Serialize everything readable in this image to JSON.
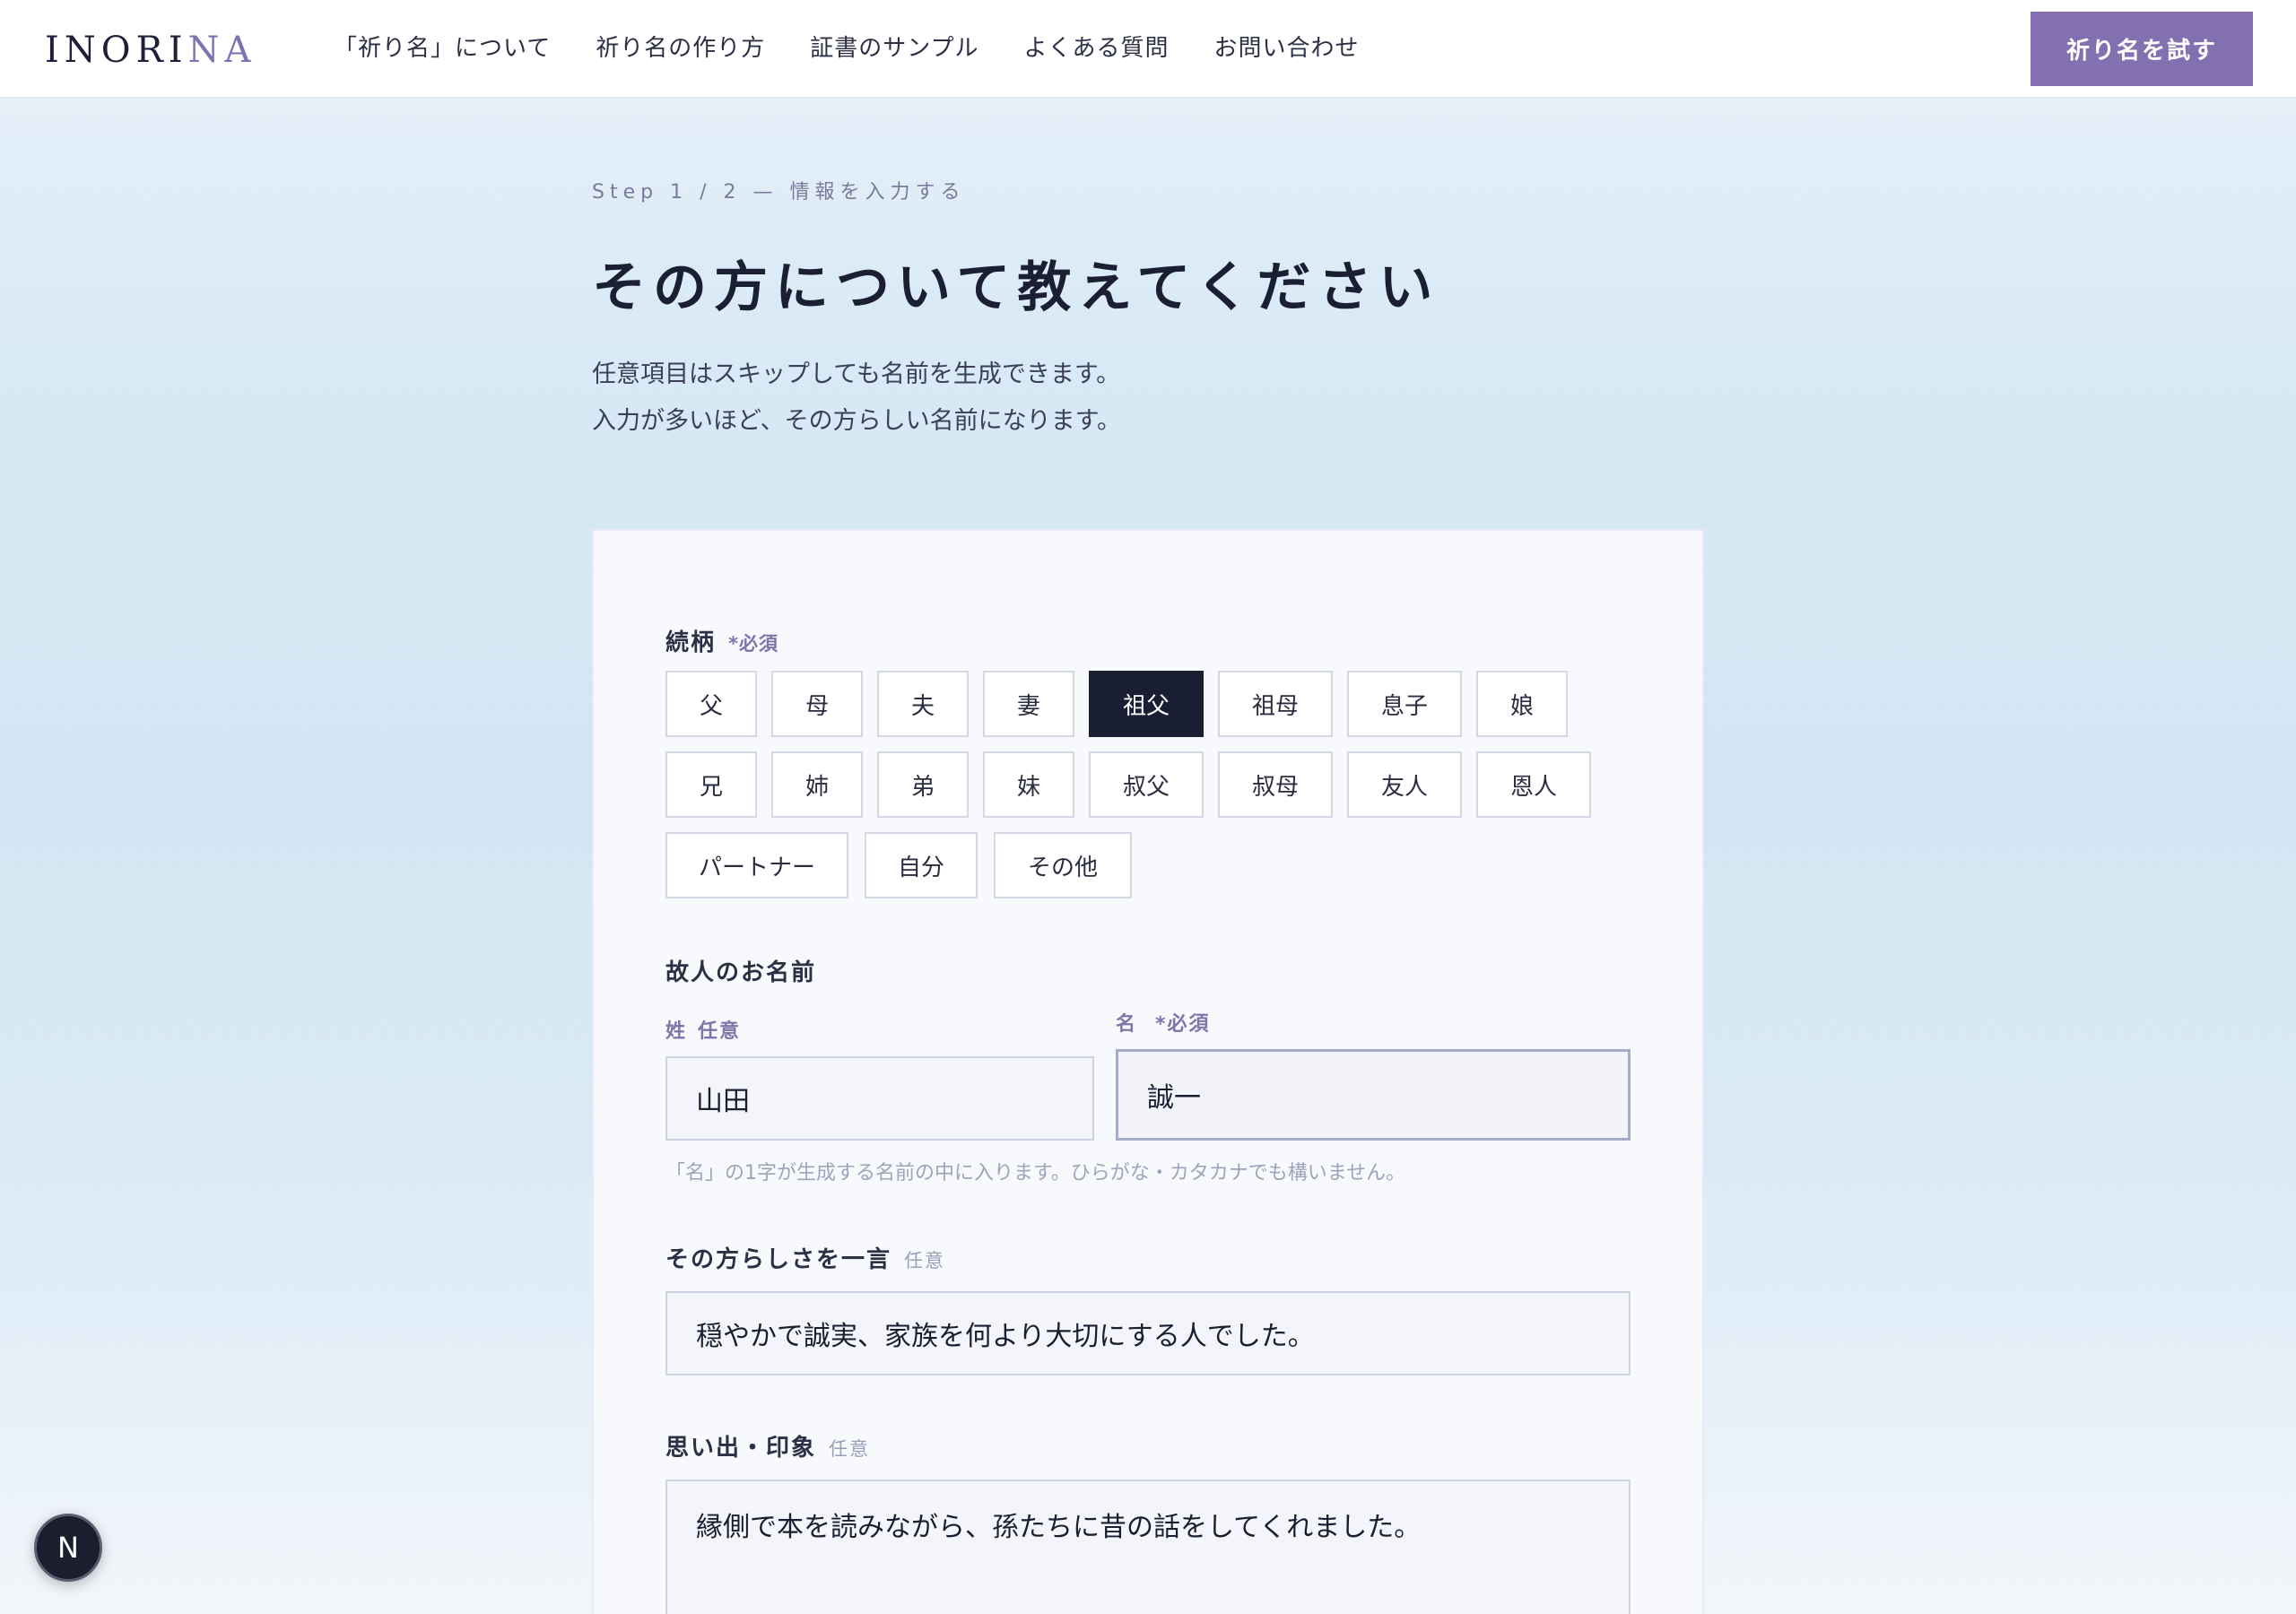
{
  "header": {
    "logo_main": "INORI",
    "logo_accent": "NA",
    "nav": [
      {
        "label": "「祈り名」について"
      },
      {
        "label": "祈り名の作り方"
      },
      {
        "label": "証書のサンプル"
      },
      {
        "label": "よくある質問"
      },
      {
        "label": "お問い合わせ"
      }
    ],
    "cta": "祈り名を試す"
  },
  "intro": {
    "step": "Step 1 / 2 — 情報を入力する",
    "title": "その方について教えてください",
    "desc_line1": "任意項目はスキップしても名前を生成できます。",
    "desc_line2": "入力が多いほど、その方らしい名前になります。"
  },
  "form": {
    "relation": {
      "label": "続柄",
      "required": "*必須",
      "row1": [
        "父",
        "母",
        "夫",
        "妻",
        "祖父",
        "祖母",
        "息子",
        "娘"
      ],
      "row2": [
        "兄",
        "姉",
        "弟",
        "妹",
        "叔父",
        "叔母",
        "友人",
        "恩人"
      ],
      "row3": [
        "パートナー",
        "自分",
        "その他"
      ],
      "selected": "祖父"
    },
    "name": {
      "label": "故人のお名前",
      "last_label": "姓",
      "last_optional": "任意",
      "last_value": "山田",
      "first_label": "名",
      "first_required": "*必須",
      "first_value": "誠一",
      "hint": "「名」の1字が生成する名前の中に入ります。ひらがな・カタカナでも構いません。"
    },
    "personality": {
      "label": "その方らしさを一言",
      "optional": "任意",
      "value": "穏やかで誠実、家族を何より大切にする人でした。"
    },
    "memory": {
      "label": "思い出・印象",
      "optional": "任意",
      "value": "縁側で本を読みながら、孫たちに昔の話をしてくれました。"
    }
  },
  "bubble": {
    "letter": "N"
  }
}
